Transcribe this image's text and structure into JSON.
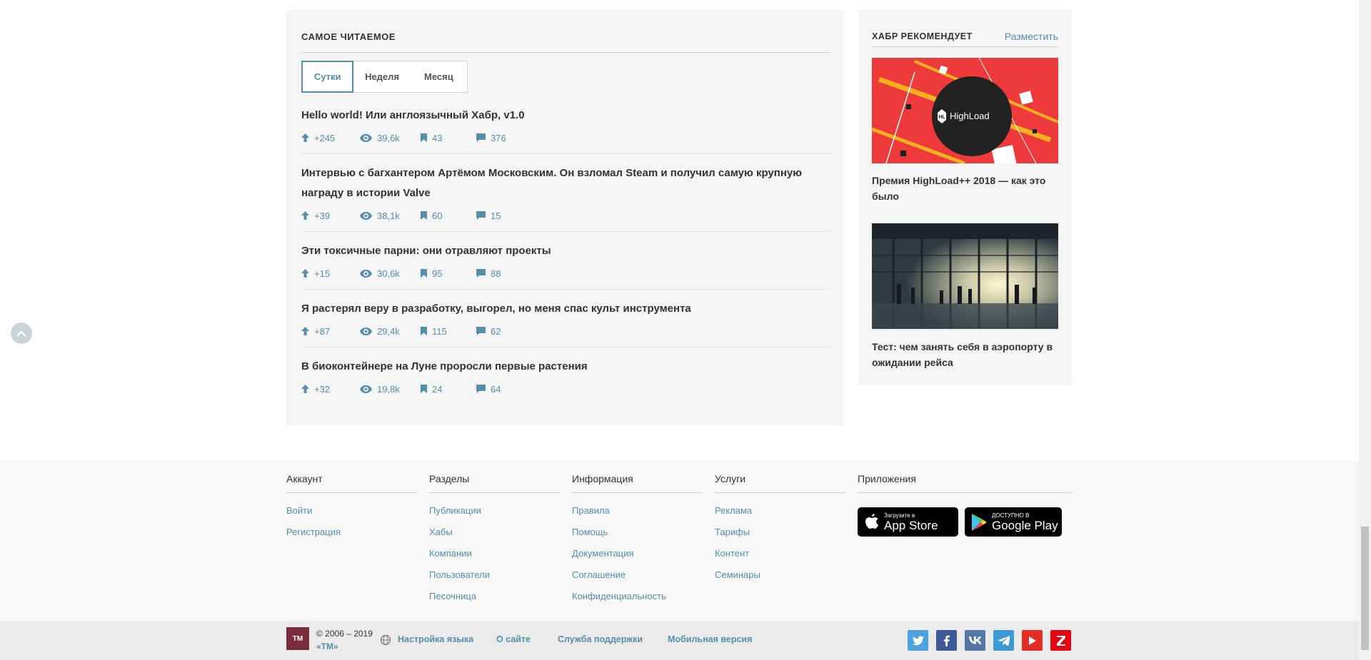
{
  "most_read": {
    "title": "САМОЕ ЧИТАЕМОЕ",
    "tabs": [
      "Сутки",
      "Неделя",
      "Месяц"
    ],
    "active_tab": "Сутки",
    "articles": [
      {
        "title": "Hello world! Или англоязычный Хабр, v1.0",
        "votes": "+245",
        "views": "39,6k",
        "bookmarks": "43",
        "comments": "376"
      },
      {
        "title": "Интервью с багхантером Артёмом Московским. Он взломал Steam и получил самую крупную награду в истории Valve",
        "votes": "+39",
        "views": "38,1k",
        "bookmarks": "60",
        "comments": "15"
      },
      {
        "title": "Эти токсичные парни: они отравляют проекты",
        "votes": "+15",
        "views": "30,6k",
        "bookmarks": "95",
        "comments": "88"
      },
      {
        "title": "Я растерял веру в разработку, выгорел, но меня спас культ инструмента",
        "votes": "+87",
        "views": "29,4k",
        "bookmarks": "115",
        "comments": "62"
      },
      {
        "title": "В биоконтейнере на Луне проросли первые растения",
        "votes": "+32",
        "views": "19,8k",
        "bookmarks": "24",
        "comments": "64"
      }
    ]
  },
  "recommends": {
    "title": "ХАБР РЕКОМЕНДУЕТ",
    "place_link": "Разместить",
    "items": [
      {
        "caption": "Премия HighLoad++ 2018 — как это было",
        "image_logo": "HighLoad",
        "image_logo_mark": "HL"
      },
      {
        "caption": "Тест: чем занять себя в аэропорту в ожидании рейса"
      }
    ]
  },
  "footer": {
    "columns": [
      {
        "heading": "Аккаунт",
        "links": [
          "Войти",
          "Регистрация"
        ]
      },
      {
        "heading": "Разделы",
        "links": [
          "Публикации",
          "Хабы",
          "Компании",
          "Пользователи",
          "Песочница"
        ]
      },
      {
        "heading": "Информация",
        "links": [
          "Правила",
          "Помощь",
          "Документация",
          "Соглашение",
          "Конфиденциальность"
        ]
      },
      {
        "heading": "Услуги",
        "links": [
          "Реклама",
          "Тарифы",
          "Контент",
          "Семинары"
        ]
      }
    ],
    "apps_heading": "Приложения",
    "app_store": {
      "small": "Загрузите в",
      "big": "App Store"
    },
    "google_play": {
      "small": "ДОСТУПНО В",
      "big": "Google Play"
    }
  },
  "bottom": {
    "logo": "TM",
    "copyright": "© 2006 – 2019",
    "tm_link": "«TM»",
    "links": [
      "Настройка языка",
      "О сайте",
      "Служба поддержки",
      "Мобильная версия"
    ],
    "social": [
      "twitter-icon",
      "facebook-icon",
      "vk-icon",
      "telegram-icon",
      "youtube-icon",
      "zen-icon"
    ]
  },
  "colors": {
    "link": "#548eaa",
    "panel_bg": "#f5f5f5",
    "footer_bg": "#f7f7f7"
  }
}
